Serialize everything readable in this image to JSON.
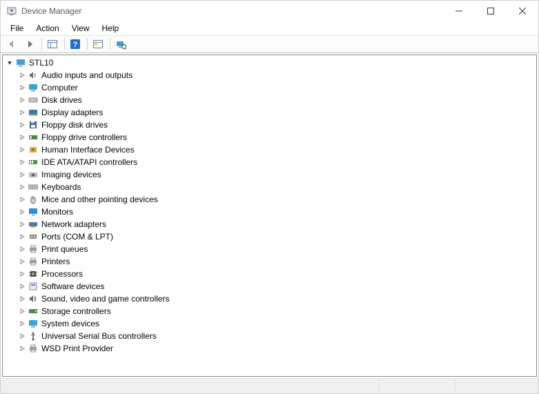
{
  "window": {
    "title": "Device Manager"
  },
  "menubar": {
    "items": [
      "File",
      "Action",
      "View",
      "Help"
    ]
  },
  "tree": {
    "root": {
      "label": "STL10",
      "icon": "computer-icon",
      "expanded": true
    },
    "children": [
      {
        "label": "Audio inputs and outputs",
        "icon": "audio-icon"
      },
      {
        "label": "Computer",
        "icon": "computer-icon"
      },
      {
        "label": "Disk drives",
        "icon": "disk-icon"
      },
      {
        "label": "Display adapters",
        "icon": "display-adapter-icon"
      },
      {
        "label": "Floppy disk drives",
        "icon": "floppy-icon"
      },
      {
        "label": "Floppy drive controllers",
        "icon": "floppy-controller-icon"
      },
      {
        "label": "Human Interface Devices",
        "icon": "hid-icon"
      },
      {
        "label": "IDE ATA/ATAPI controllers",
        "icon": "ide-icon"
      },
      {
        "label": "Imaging devices",
        "icon": "imaging-icon"
      },
      {
        "label": "Keyboards",
        "icon": "keyboard-icon"
      },
      {
        "label": "Mice and other pointing devices",
        "icon": "mouse-icon"
      },
      {
        "label": "Monitors",
        "icon": "monitor-icon"
      },
      {
        "label": "Network adapters",
        "icon": "network-icon"
      },
      {
        "label": "Ports (COM & LPT)",
        "icon": "port-icon"
      },
      {
        "label": "Print queues",
        "icon": "printer-icon"
      },
      {
        "label": "Printers",
        "icon": "printer-icon"
      },
      {
        "label": "Processors",
        "icon": "processor-icon"
      },
      {
        "label": "Software devices",
        "icon": "software-icon"
      },
      {
        "label": "Sound, video and game controllers",
        "icon": "sound-icon"
      },
      {
        "label": "Storage controllers",
        "icon": "storage-icon"
      },
      {
        "label": "System devices",
        "icon": "system-icon"
      },
      {
        "label": "Universal Serial Bus controllers",
        "icon": "usb-icon"
      },
      {
        "label": "WSD Print Provider",
        "icon": "printer-icon"
      }
    ]
  }
}
